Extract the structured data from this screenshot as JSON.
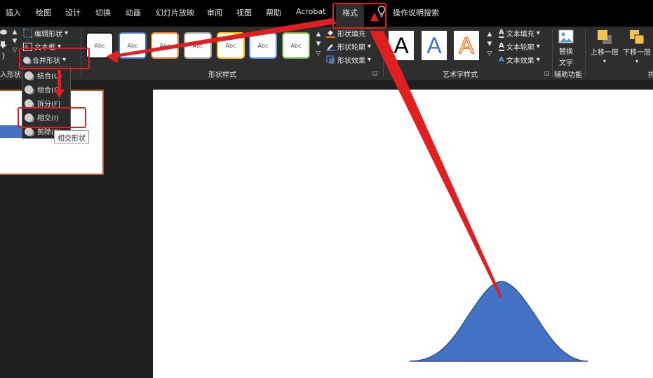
{
  "tabs": [
    "插入",
    "绘图",
    "设计",
    "切换",
    "动画",
    "幻灯片放映",
    "审阅",
    "视图",
    "帮助",
    "Acrobat",
    "格式",
    "操作说明搜索"
  ],
  "insert_group": {
    "edit_shape": "编辑形状",
    "text_box": "文本框",
    "merge_shapes": "合并形状",
    "label": "入形状"
  },
  "merge_menu": {
    "items": [
      "结合(U)",
      "组合(C)",
      "拆分(F)",
      "相交(I)",
      "剪除(S)"
    ],
    "tooltip": "相交形状"
  },
  "shape_styles": {
    "gallery_text": "Abc",
    "gallery_colors": [
      "#1a1a1a",
      "#4472c4",
      "#ed7d31",
      "#a5a5a5",
      "#ffc000",
      "#5b9bd5",
      "#70ad47"
    ],
    "fill": "形状填充",
    "outline": "形状轮廓",
    "effects": "形状效果",
    "label": "形状样式"
  },
  "wordart": {
    "letters": [
      "A",
      "A",
      "A"
    ],
    "colors": [
      "#000000",
      "#4472c4",
      "#ed7d31"
    ],
    "text_fill": "文本填充",
    "text_outline": "文本轮廓",
    "text_effects": "文本效果",
    "label": "艺术字样式"
  },
  "accessibility": {
    "alt_text_line1": "替换",
    "alt_text_line2": "文字",
    "label": "辅助功能"
  },
  "arrange": {
    "bring_forward": "上移一层",
    "send_backward": "下移一层",
    "label": "排"
  },
  "theme": {
    "accent_red": "#e02020",
    "shape_fill": "#4472c4",
    "shape_outline": "#2f5597"
  }
}
